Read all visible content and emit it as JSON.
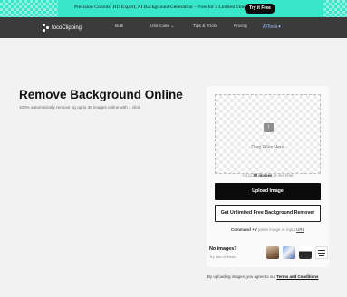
{
  "promo": {
    "message": "Precision Cutouts, HD Export, AI Background Generation – Free for a Limited Time",
    "cta": "Try it Free"
  },
  "nav": {
    "logo_text": "focoClipping",
    "items": [
      "Bulk",
      "Use Case ⌄",
      "Tips & Tricks",
      "Pricing"
    ],
    "ai_tools": "AITools"
  },
  "hero": {
    "title": "Remove Background Online",
    "subtitle": "100% automatically remove bg up to 30 images online with 1 click"
  },
  "upload": {
    "drop_label": "Drag Files Here",
    "limit_prefix": "Up to ",
    "limit_bold": "30 images",
    "limit_suffix": " at one time",
    "upload_button": "Upload Image",
    "unlimited_button": "Get Unlimited Free Background Remover",
    "hint_shortcut": "Command +V",
    "hint_middle": " paste image or input ",
    "hint_url": "URL"
  },
  "samples": {
    "title": "No images?",
    "subtitle": "Try one of these:"
  },
  "terms": {
    "prefix": "By uploading images, you agree to our ",
    "link": "Terms and Conditions"
  },
  "colors": {
    "promo_bg": "#38e6c9",
    "nav_bg": "#3b3b3b",
    "page_bg": "#f1f2f1",
    "primary_button": "#0b0b0b",
    "ai_tools_accent": "#9fc2ff"
  }
}
